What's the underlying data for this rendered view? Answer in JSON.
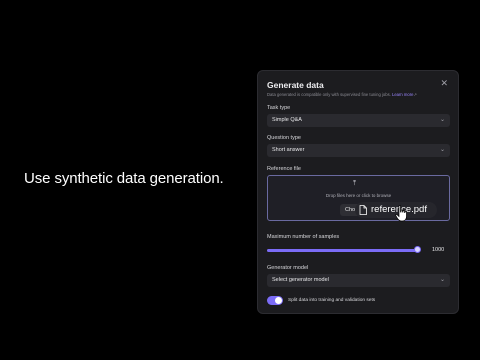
{
  "tagline": "Use synthetic data generation.",
  "dialog": {
    "title": "Generate data",
    "close_glyph": "✕",
    "note": "Data generated is compatible only with supervised fine tuning jobs.",
    "learn_more": "Learn more",
    "task_type": {
      "label": "Task type",
      "value": "Simple Q&A"
    },
    "question_type": {
      "label": "Question type",
      "value": "Short answer"
    },
    "reference_file": {
      "label": "Reference file",
      "drop_text": "Drop files here or click to browse",
      "choose_label": "Cho",
      "dragged_file": "reference.pdf"
    },
    "max_samples": {
      "label": "Maximum number of samples",
      "value": "1000",
      "fill": 0.98
    },
    "generator_model": {
      "label": "Generator model",
      "value": "Select generator model"
    },
    "split_toggle": {
      "label": "Split data into training and validation sets",
      "on": true
    }
  },
  "colors": {
    "accent": "#7b6cf6",
    "panel": "#1c1c1f",
    "background": "#000000"
  },
  "icons": [
    "close-icon",
    "chevron-down-icon",
    "upload-icon",
    "file-icon",
    "cursor-icon"
  ]
}
